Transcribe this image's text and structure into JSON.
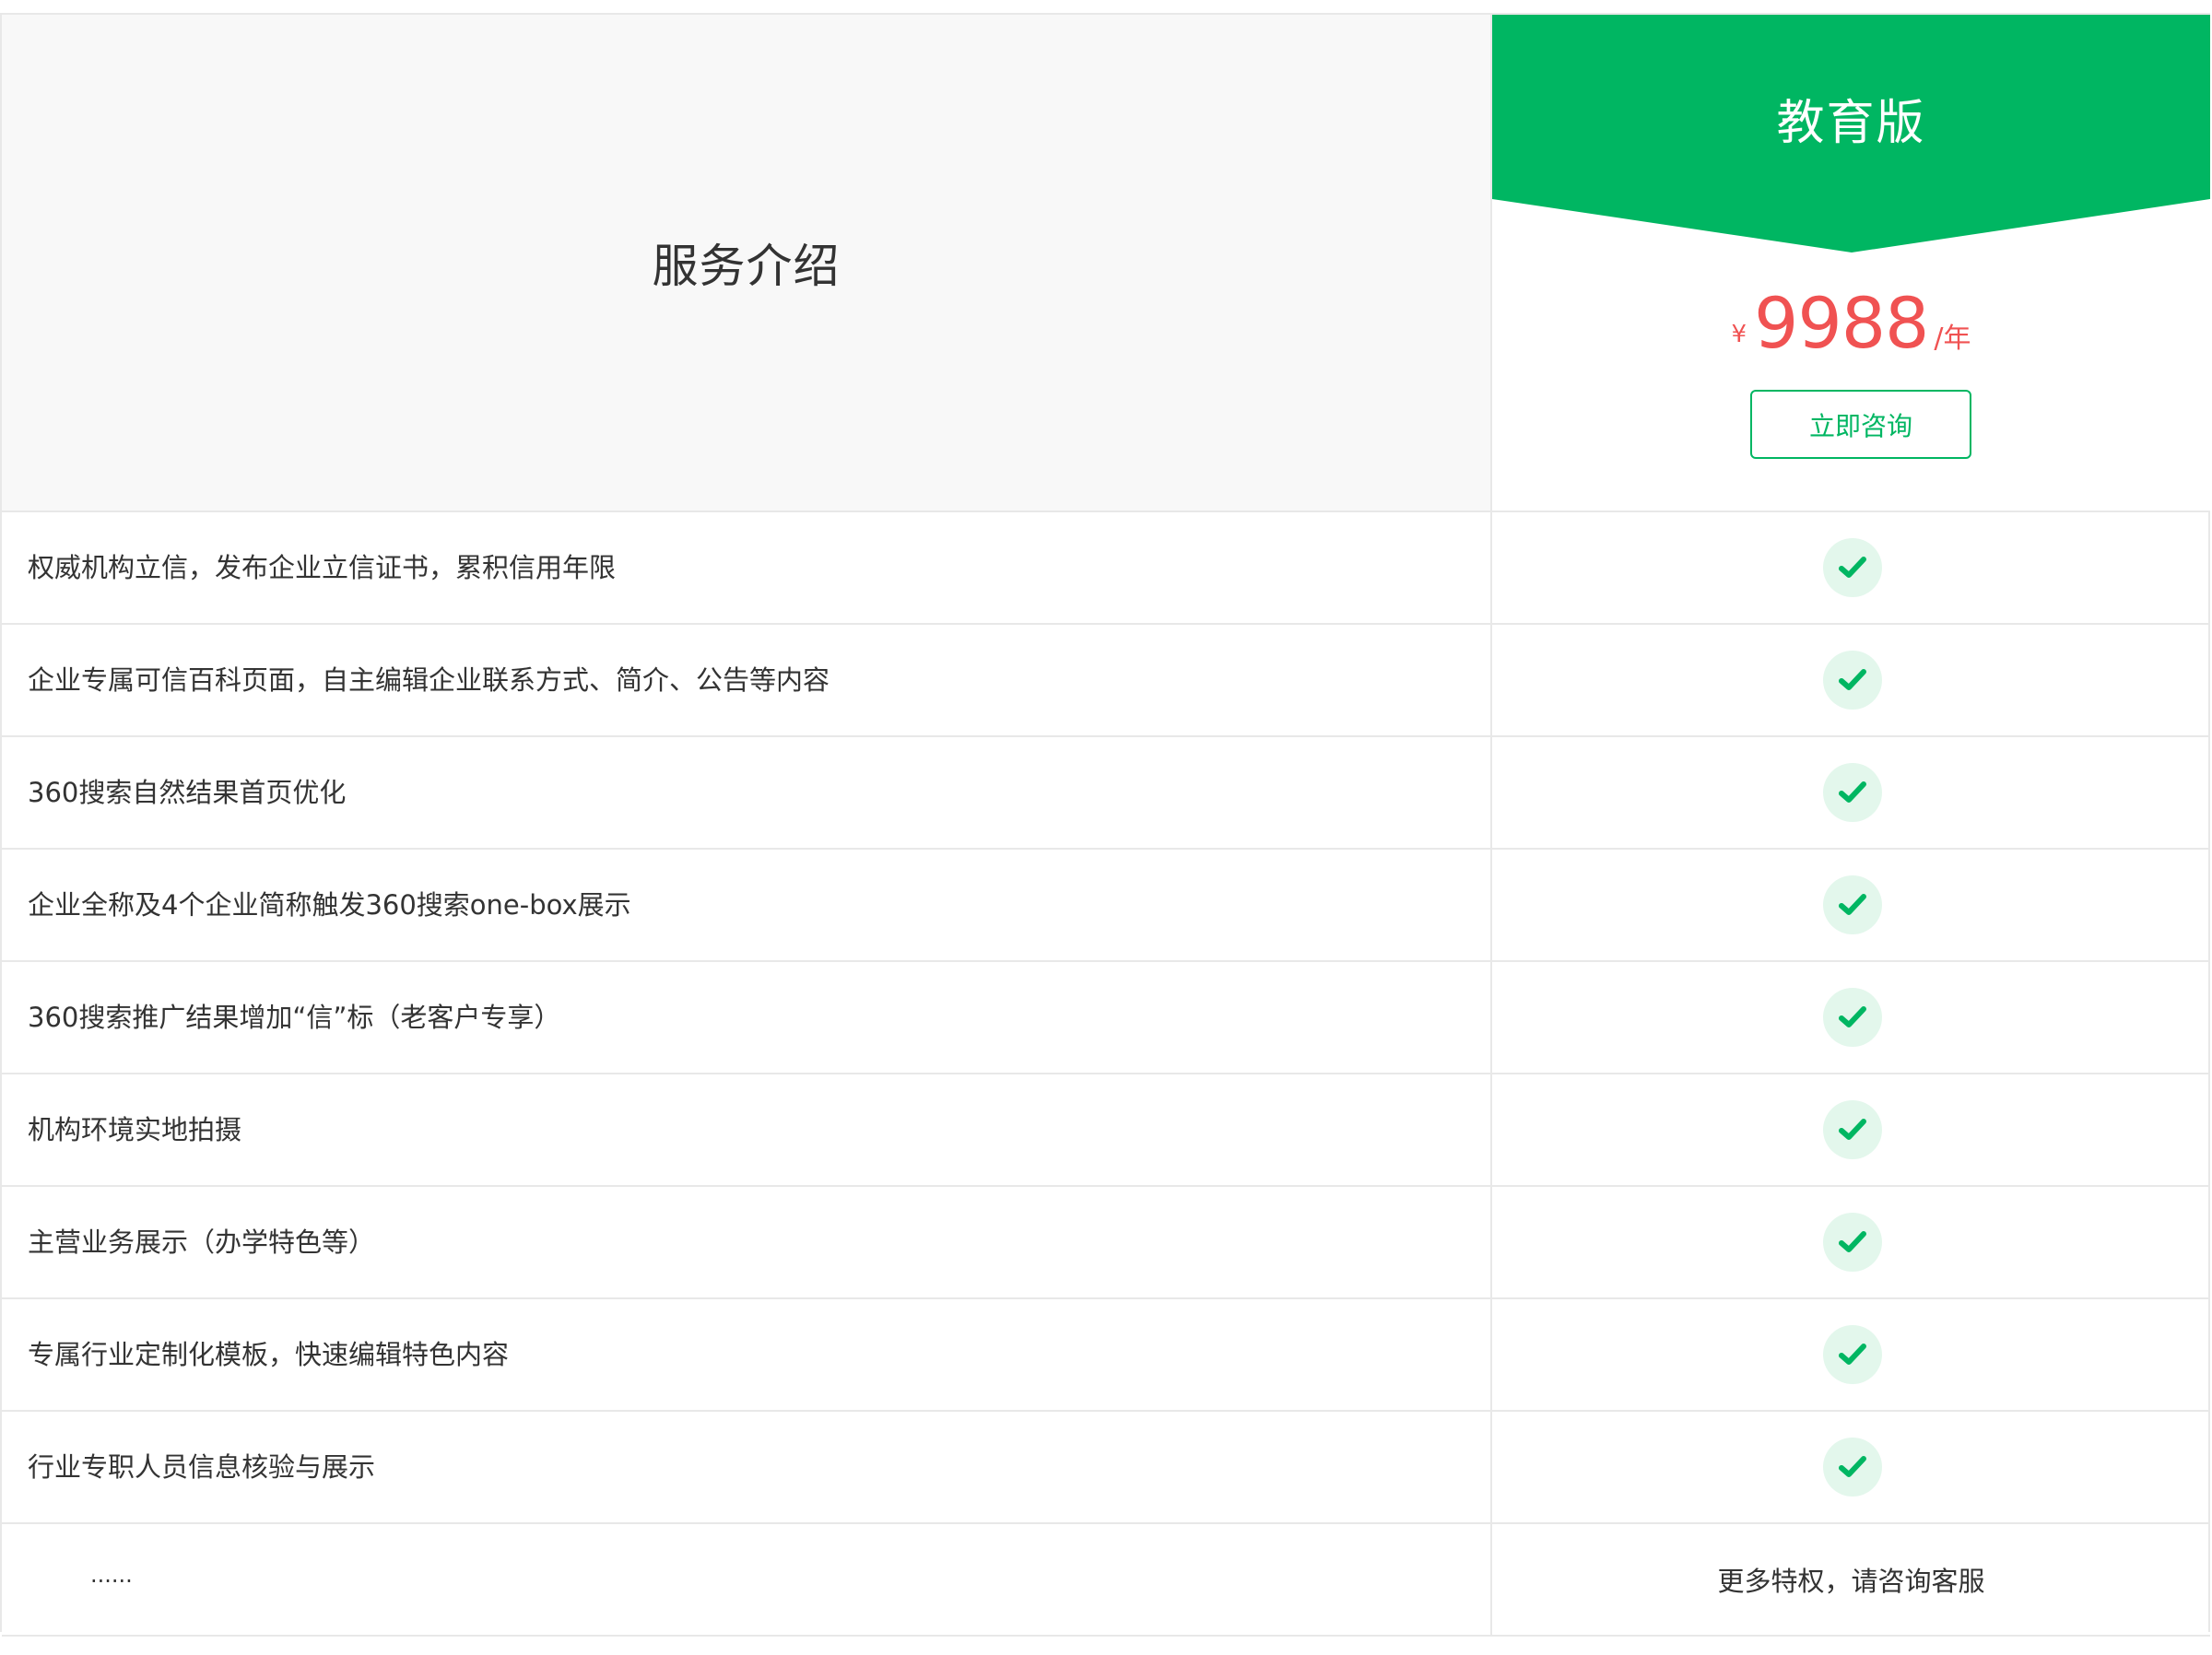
{
  "header": {
    "service_intro_title": "服务介绍",
    "plan_name": "教育版",
    "price_currency": "¥",
    "price_amount": "9988",
    "price_unit": "/年",
    "consult_label": "立即咨询"
  },
  "features": [
    {
      "label": "权威机构立信，发布企业立信证书，累积信用年限",
      "included": true
    },
    {
      "label": "企业专属可信百科页面，自主编辑企业联系方式、简介、公告等内容",
      "included": true
    },
    {
      "label": "360搜索自然结果首页优化",
      "included": true
    },
    {
      "label": "企业全称及4个企业简称触发360搜索one-box展示",
      "included": true
    },
    {
      "label": "360搜索推广结果增加“信”标（老客户专享）",
      "included": true
    },
    {
      "label": "机构环境实地拍摄",
      "included": true
    },
    {
      "label": "主营业务展示（办学特色等）",
      "included": true
    },
    {
      "label": "专属行业定制化模板，快速编辑特色内容",
      "included": true
    },
    {
      "label": "行业专职人员信息核验与展示",
      "included": true
    }
  ],
  "footer_row": {
    "ellipsis": "......",
    "note": "更多特权，请咨询客服"
  },
  "colors": {
    "accent_green": "#00b662",
    "price_red": "#f05252",
    "check_bg": "#e3f7ec",
    "header_gray": "#f8f8f8"
  },
  "icons": {
    "check": "check-icon"
  }
}
